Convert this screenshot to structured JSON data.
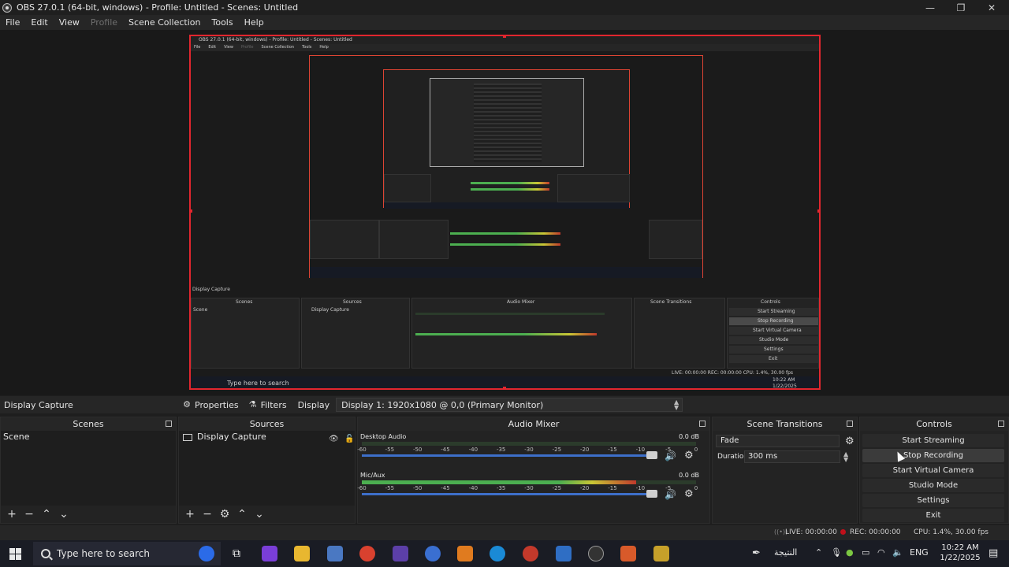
{
  "window": {
    "title": "OBS 27.0.1 (64-bit, windows) - Profile: Untitled - Scenes: Untitled",
    "minimize": "—",
    "maximize": "❐",
    "close": "✕"
  },
  "menu": {
    "file": "File",
    "edit": "Edit",
    "view": "View",
    "profile": "Profile",
    "scene_collection": "Scene Collection",
    "tools": "Tools",
    "help": "Help"
  },
  "preview": {
    "source_label": "Display Capture",
    "nested_title": "OBS 27.0.1 (64-bit, windows) - Profile: Untitled - Scenes: Untitled",
    "nested_search": "Type here to search",
    "nested_docks": [
      "Scenes",
      "Sources",
      "Audio Mixer",
      "Scene Transitions",
      "Controls"
    ],
    "nested_scene": "Scene",
    "nested_source": "Display Capture",
    "nested_time": "10:22 AM",
    "nested_date": "1/22/2025",
    "nested_buttons": [
      "Start Streaming",
      "Stop Recording",
      "Start Virtual Camera",
      "Studio Mode",
      "Settings",
      "Exit"
    ],
    "nested_status": "LIVE: 00:00:00   REC: 00:00:00   CPU: 1.4%, 30.00 fps"
  },
  "toolbar": {
    "selected_source": "Display Capture",
    "properties": "Properties",
    "filters": "Filters",
    "display_label": "Display",
    "display_value": "Display 1: 1920x1080 @ 0,0 (Primary Monitor)"
  },
  "scenes": {
    "title": "Scenes",
    "items": [
      "Scene"
    ]
  },
  "sources": {
    "title": "Sources",
    "items": [
      "Display Capture"
    ]
  },
  "mixer": {
    "title": "Audio Mixer",
    "ticks": [
      "-60",
      "-55",
      "-50",
      "-45",
      "-40",
      "-35",
      "-30",
      "-25",
      "-20",
      "-15",
      "-10",
      "-5",
      "0"
    ],
    "channels": [
      {
        "name": "Desktop Audio",
        "db": "0.0 dB",
        "level": 0.0,
        "volume": 1.0
      },
      {
        "name": "Mic/Aux",
        "db": "0.0 dB",
        "level": 0.82,
        "volume": 1.0
      }
    ]
  },
  "transitions": {
    "title": "Scene Transitions",
    "type": "Fade",
    "duration_label": "Duration",
    "duration_value": "300 ms"
  },
  "controls": {
    "title": "Controls",
    "start_streaming": "Start Streaming",
    "stop_recording": "Stop Recording",
    "start_virtual_camera": "Start Virtual Camera",
    "studio_mode": "Studio Mode",
    "settings": "Settings",
    "exit": "Exit"
  },
  "status": {
    "live": "LIVE: 00:00:00",
    "rec": "REC: 00:00:00",
    "cpu": "CPU: 1.4%, 30.00 fps"
  },
  "taskbar": {
    "search_placeholder": "Type here to search",
    "lang": "ENG",
    "arabic_label": "النتيجة",
    "time": "10:22 AM",
    "date": "1/22/2025"
  },
  "colors": {
    "preview_border": "#e2262e",
    "meter_green": "#4caf50",
    "meter_yellow": "#c9c635",
    "meter_red": "#c0392b",
    "slider_blue": "#3d6fc9",
    "rec_red": "#c0101a"
  }
}
